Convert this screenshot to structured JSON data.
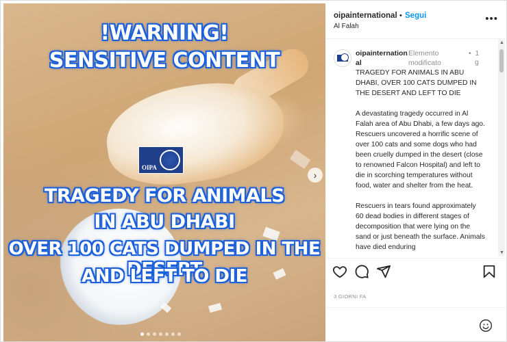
{
  "media": {
    "warning_line1": "!WARNING!",
    "warning_line2": "SENSITIVE CONTENT",
    "headline_line1": "TRAGEDY FOR ANIMALS",
    "headline_line2": "IN ABU DHABI",
    "headline_line3": "OVER 100 CATS DUMPED IN THE DESERT",
    "headline_line4": "AND LEFT TO DIE",
    "logo_text": "OIPA",
    "next_icon": "chevron-right-icon",
    "slide_count": 7,
    "active_slide": 1
  },
  "header": {
    "username": "oipainternational",
    "separator": "•",
    "follow_label": "Segui",
    "location": "Al Falah",
    "more_icon": "more-horizontal-icon"
  },
  "caption": {
    "username": "oipainternational",
    "edited_label": "Elemento modificato",
    "time_sep": "•",
    "time": "1",
    "time_unit": "g",
    "paragraphs": [
      "TRAGEDY FOR ANIMALS IN ABU DHABI, OVER 100 CATS DUMPED IN THE DESERT AND LEFT TO DIE",
      "A devastating tragedy occurred in Al Falah area of Abu Dhabi, a few days ago. Rescuers uncovered a horrific scene of over 100 cats and some dogs who had been cruelly dumped in the desert (close to renowned Falcon Hospital) and left to die in scorching temperatures without food, water and shelter from the heat.",
      "Rescuers in tears found approximately 60 dead bodies in different stages of decomposition that were lying on the sand or just beneath the surface. Animals have died enduring"
    ]
  },
  "actions": {
    "like_icon": "heart-icon",
    "comment_icon": "comment-icon",
    "share_icon": "send-icon",
    "save_icon": "bookmark-icon"
  },
  "posted_ago": "3 GIORNI FA",
  "comment": {
    "emoji_icon": "emoji-icon"
  },
  "colors": {
    "follow_blue": "#0095f6",
    "overlay_outline": "#1e63e0"
  }
}
